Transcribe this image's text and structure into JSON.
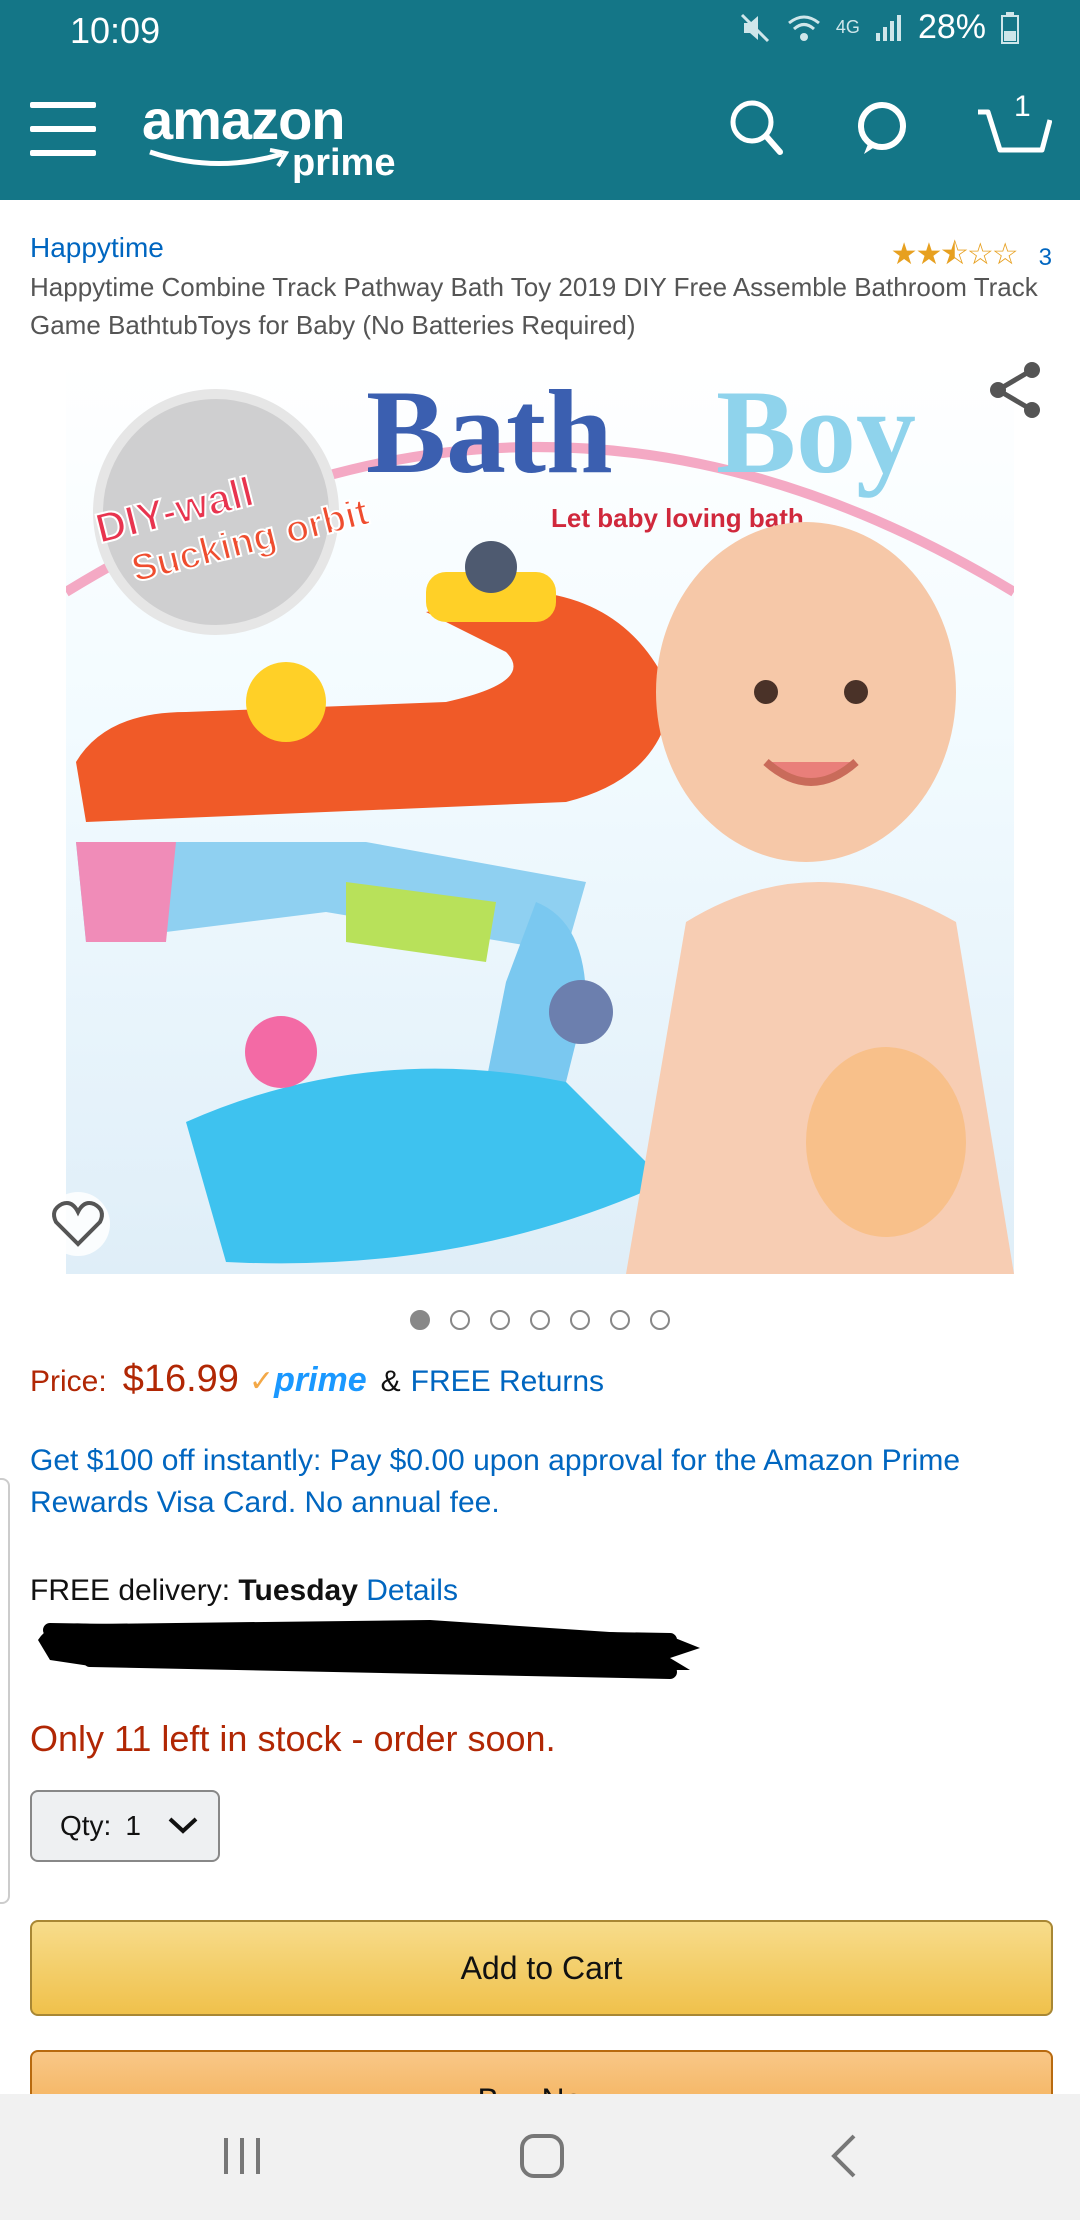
{
  "status_bar": {
    "time": "10:09",
    "network": "4G",
    "battery": "28%"
  },
  "header": {
    "logo_main": "amazon",
    "logo_sub": "prime",
    "cart_count": "1",
    "bg_color": "#147687"
  },
  "product": {
    "brand": "Happytime",
    "rating_stars": "★★⯪☆☆",
    "rating_value": 2.5,
    "rating_count": "3",
    "title": "Happytime Combine Track Pathway Bath Toy 2019 DIY Free Assemble Bathroom Track Game BathtubToys for Baby (No Batteries Required)"
  },
  "image": {
    "headline_1": "Bath",
    "headline_2": "Boy",
    "tagline": "Let baby loving bath",
    "badge_line1": "DIY-wall",
    "badge_line2": "Sucking orbit",
    "carousel_count": 7,
    "carousel_active": 1
  },
  "price": {
    "label": "Price:",
    "value": "$16.99",
    "prime_check": "✓",
    "prime_text": "prime",
    "amp": "&",
    "returns": "FREE Returns"
  },
  "promo": {
    "text": "Get $100 off instantly: Pay $0.00 upon approval for the Amazon Prime Rewards Visa Card. No annual fee."
  },
  "delivery": {
    "prefix": "FREE delivery:",
    "day": "Tuesday",
    "details": "Details"
  },
  "stock": {
    "text": "Only 11 left in stock - order soon."
  },
  "quantity": {
    "label": "Qty:",
    "value": "1"
  },
  "buttons": {
    "add_to_cart": "Add to Cart",
    "buy_now": "Buy Now"
  }
}
